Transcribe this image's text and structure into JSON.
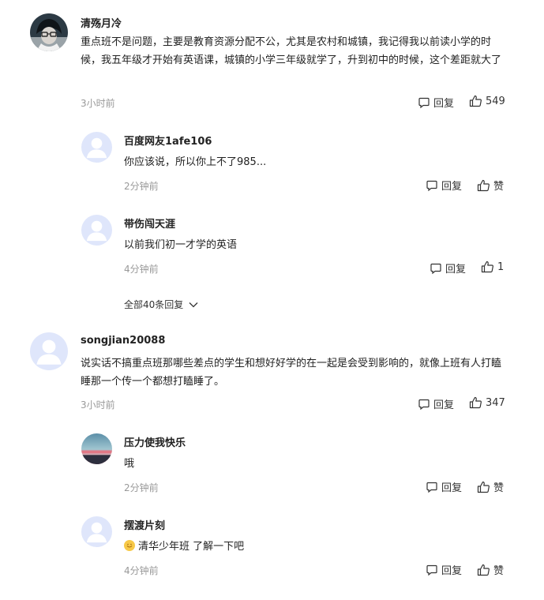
{
  "comments": [
    {
      "user": "清殇月冷",
      "text": "重点班不是问题，主要是教育资源分配不公，尤其是农村和城镇，我记得我以前读小学的时候，我五年级才开始有英语课，城镇的小学三年级就学了，升到初中的时候，这个差距就大了",
      "time": "3小时前",
      "reply_label": "回复",
      "likes": "549",
      "avatar": "dark-character-avatar",
      "replies": [
        {
          "user": "百度网友1afe106",
          "text": "你应该说，所以你上不了985...",
          "time": "2分钟前",
          "reply_label": "回复",
          "like_label": "赞",
          "avatar": "default-avatar"
        },
        {
          "user": "带伤闯天涯",
          "text": "以前我们初一才学的英语",
          "time": "4分钟前",
          "reply_label": "回复",
          "like_label": "1",
          "avatar": "default-avatar"
        }
      ],
      "more_label": "全部40条回复"
    },
    {
      "user": "songjian20088",
      "text": "说实话不搞重点班那哪些差点的学生和想好好学的在一起是会受到影响的，就像上班有人打瞌睡那一个传一个都想打瞌睡了。",
      "time": "3小时前",
      "reply_label": "回复",
      "likes": "347",
      "avatar": "default-avatar",
      "replies": [
        {
          "user": "压力使我快乐",
          "text": "哦",
          "time": "2分钟前",
          "reply_label": "回复",
          "like_label": "赞",
          "avatar": "sunset-avatar"
        },
        {
          "user": "摆渡片刻",
          "text": "清华少年班 了解一下吧",
          "time": "4分钟前",
          "reply_label": "回复",
          "like_label": "赞",
          "avatar": "default-avatar",
          "emoji": "smile-emoji"
        }
      ]
    }
  ],
  "colors": {
    "text": "#222222",
    "muted": "#999999",
    "icon": "#333333",
    "avatar_bg": "#dfe6fb"
  }
}
